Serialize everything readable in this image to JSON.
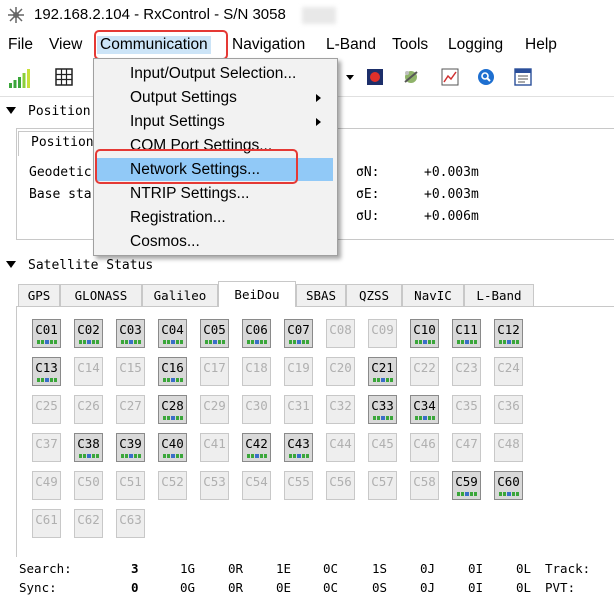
{
  "window": {
    "title": "192.168.2.104 - RxControl - S/N 3058"
  },
  "menubar": {
    "items": [
      "File",
      "View",
      "Communication",
      "Navigation",
      "L-Band",
      "Tools",
      "Logging",
      "Help"
    ],
    "active": "Communication"
  },
  "toolbar": {
    "icons": [
      "signal-strength-icon",
      "grid-icon",
      "dropdown-arrow-icon",
      "record-icon",
      "satellite-icon",
      "chart-icon",
      "search-icon",
      "list-window-icon"
    ]
  },
  "position": {
    "section_title": "Position",
    "tab_label": "Position",
    "rows": [
      {
        "label": "Geodetic",
        "sigma": "σN:",
        "value": "+0.003m"
      },
      {
        "label": "Base sta",
        "sigma": "σE:",
        "value": "+0.003m"
      },
      {
        "label": "",
        "sigma": "σU:",
        "value": "+0.006m"
      }
    ]
  },
  "satellite_status": {
    "section_title": "Satellite Status",
    "tabs": [
      "GPS",
      "GLONASS",
      "Galileo",
      "BeiDou",
      "SBAS",
      "QZSS",
      "NavIC",
      "L-Band"
    ],
    "selected_tab": "BeiDou",
    "satellites": [
      {
        "id": "C01",
        "on": true
      },
      {
        "id": "C02",
        "on": true
      },
      {
        "id": "C03",
        "on": true
      },
      {
        "id": "C04",
        "on": true
      },
      {
        "id": "C05",
        "on": true
      },
      {
        "id": "C06",
        "on": true
      },
      {
        "id": "C07",
        "on": true
      },
      {
        "id": "C08",
        "on": false
      },
      {
        "id": "C09",
        "on": false
      },
      {
        "id": "C10",
        "on": true
      },
      {
        "id": "C11",
        "on": true
      },
      {
        "id": "C12",
        "on": true
      },
      {
        "id": "C13",
        "on": true
      },
      {
        "id": "C14",
        "on": false
      },
      {
        "id": "C15",
        "on": false
      },
      {
        "id": "C16",
        "on": true
      },
      {
        "id": "C17",
        "on": false
      },
      {
        "id": "C18",
        "on": false
      },
      {
        "id": "C19",
        "on": false
      },
      {
        "id": "C20",
        "on": false
      },
      {
        "id": "C21",
        "on": true
      },
      {
        "id": "C22",
        "on": false
      },
      {
        "id": "C23",
        "on": false
      },
      {
        "id": "C24",
        "on": false
      },
      {
        "id": "C25",
        "on": false
      },
      {
        "id": "C26",
        "on": false
      },
      {
        "id": "C27",
        "on": false
      },
      {
        "id": "C28",
        "on": true
      },
      {
        "id": "C29",
        "on": false
      },
      {
        "id": "C30",
        "on": false
      },
      {
        "id": "C31",
        "on": false
      },
      {
        "id": "C32",
        "on": false
      },
      {
        "id": "C33",
        "on": true
      },
      {
        "id": "C34",
        "on": true
      },
      {
        "id": "C35",
        "on": false
      },
      {
        "id": "C36",
        "on": false
      },
      {
        "id": "C37",
        "on": false
      },
      {
        "id": "C38",
        "on": true
      },
      {
        "id": "C39",
        "on": true
      },
      {
        "id": "C40",
        "on": true
      },
      {
        "id": "C41",
        "on": false
      },
      {
        "id": "C42",
        "on": true
      },
      {
        "id": "C43",
        "on": true
      },
      {
        "id": "C44",
        "on": false
      },
      {
        "id": "C45",
        "on": false
      },
      {
        "id": "C46",
        "on": false
      },
      {
        "id": "C47",
        "on": false
      },
      {
        "id": "C48",
        "on": false
      },
      {
        "id": "C49",
        "on": false
      },
      {
        "id": "C50",
        "on": false
      },
      {
        "id": "C51",
        "on": false
      },
      {
        "id": "C52",
        "on": false
      },
      {
        "id": "C53",
        "on": false
      },
      {
        "id": "C54",
        "on": false
      },
      {
        "id": "C55",
        "on": false
      },
      {
        "id": "C56",
        "on": false
      },
      {
        "id": "C57",
        "on": false
      },
      {
        "id": "C58",
        "on": false
      },
      {
        "id": "C59",
        "on": true
      },
      {
        "id": "C60",
        "on": true
      },
      {
        "id": "C61",
        "on": false
      },
      {
        "id": "C62",
        "on": false
      },
      {
        "id": "C63",
        "on": false
      }
    ]
  },
  "stats": {
    "search": {
      "label": "Search:",
      "values": [
        "3",
        "1G",
        "0R",
        "1E",
        "0C",
        "1S",
        "0J",
        "0I",
        "0L"
      ],
      "tail": "Track:"
    },
    "sync": {
      "label": "Sync:",
      "values": [
        "0",
        "0G",
        "0R",
        "0E",
        "0C",
        "0S",
        "0J",
        "0I",
        "0L"
      ],
      "tail": "PVT:"
    }
  },
  "dropdown": {
    "items": [
      {
        "label": "Input/Output Selection...",
        "submenu": false
      },
      {
        "label": "Output Settings",
        "submenu": true
      },
      {
        "label": "Input Settings",
        "submenu": true
      },
      {
        "label": "COM Port Settings...",
        "submenu": false
      },
      {
        "label": "Network Settings...",
        "submenu": false,
        "highlighted": true
      },
      {
        "label": "NTRIP Settings...",
        "submenu": false
      },
      {
        "label": "Registration...",
        "submenu": false
      },
      {
        "label": "Cosmos...",
        "submenu": false
      }
    ]
  },
  "colors": {
    "highlight_box": "#e53935",
    "menu_hover": "#91c9f7",
    "active_menu": "#cce4f7"
  }
}
